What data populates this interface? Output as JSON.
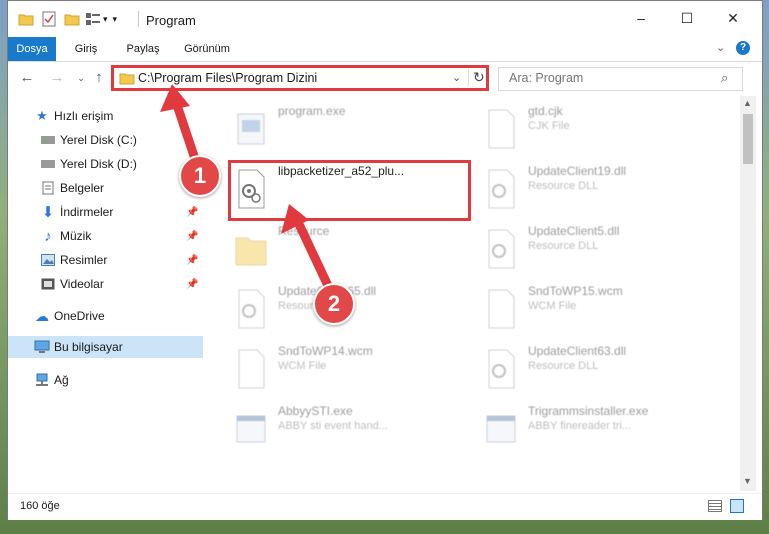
{
  "window": {
    "title": "Program",
    "controls": {
      "minimize": "–",
      "maximize": "☐",
      "close": "✕"
    }
  },
  "ribbon": {
    "tabs": [
      "Dosya",
      "Giriş",
      "Paylaş",
      "Görünüm"
    ],
    "help": "?"
  },
  "address": {
    "path": "C:\\Program Files\\Program Dizini",
    "search_placeholder": "Ara: Program"
  },
  "nav": {
    "items": [
      {
        "label": "Hızlı erişim",
        "icon": "star-icon",
        "pinned": false
      },
      {
        "label": "Yerel Disk (C:)",
        "icon": "drive-icon",
        "pinned": false
      },
      {
        "label": "Yerel Disk (D:)",
        "icon": "drive-icon",
        "pinned": false
      },
      {
        "label": "Belgeler",
        "icon": "documents-icon",
        "pinned": false
      },
      {
        "label": "İndirmeler",
        "icon": "download-icon",
        "pinned": true
      },
      {
        "label": "Müzik",
        "icon": "music-icon",
        "pinned": true
      },
      {
        "label": "Resimler",
        "icon": "pictures-icon",
        "pinned": true
      },
      {
        "label": "Videolar",
        "icon": "videos-icon",
        "pinned": true
      },
      {
        "label": "OneDrive",
        "icon": "cloud-icon",
        "pinned": false
      },
      {
        "label": "Bu bilgisayar",
        "icon": "computer-icon",
        "pinned": false
      },
      {
        "label": "Ağ",
        "icon": "network-icon",
        "pinned": false
      }
    ]
  },
  "files": [
    {
      "name": "program.exe",
      "type": ""
    },
    {
      "name": "gtd.cjk",
      "type": "CJK File"
    },
    {
      "name": "libpacketizer_a52_plu...",
      "type": ""
    },
    {
      "name": "UpdateClient19.dll",
      "type": "Resource DLL"
    },
    {
      "name": "Resource",
      "type": ""
    },
    {
      "name": "UpdateClient5.dll",
      "type": "Resource DLL"
    },
    {
      "name": "UpdateClient65.dll",
      "type": "Resource DLL"
    },
    {
      "name": "SndToWP15.wcm",
      "type": "WCM File"
    },
    {
      "name": "SndToWP14.wcm",
      "type": "WCM File"
    },
    {
      "name": "UpdateClient63.dll",
      "type": "Resource DLL"
    },
    {
      "name": "AbbyySTI.exe",
      "type": "ABBY sti event hand..."
    },
    {
      "name": "Trigrammsinstaller.exe",
      "type": "ABBY finereader tri..."
    }
  ],
  "status": {
    "count": "160 öğe"
  },
  "annotations": {
    "step1": "1",
    "step2": "2"
  },
  "colors": {
    "accent": "#1979ca",
    "highlight": "#e0393e"
  }
}
